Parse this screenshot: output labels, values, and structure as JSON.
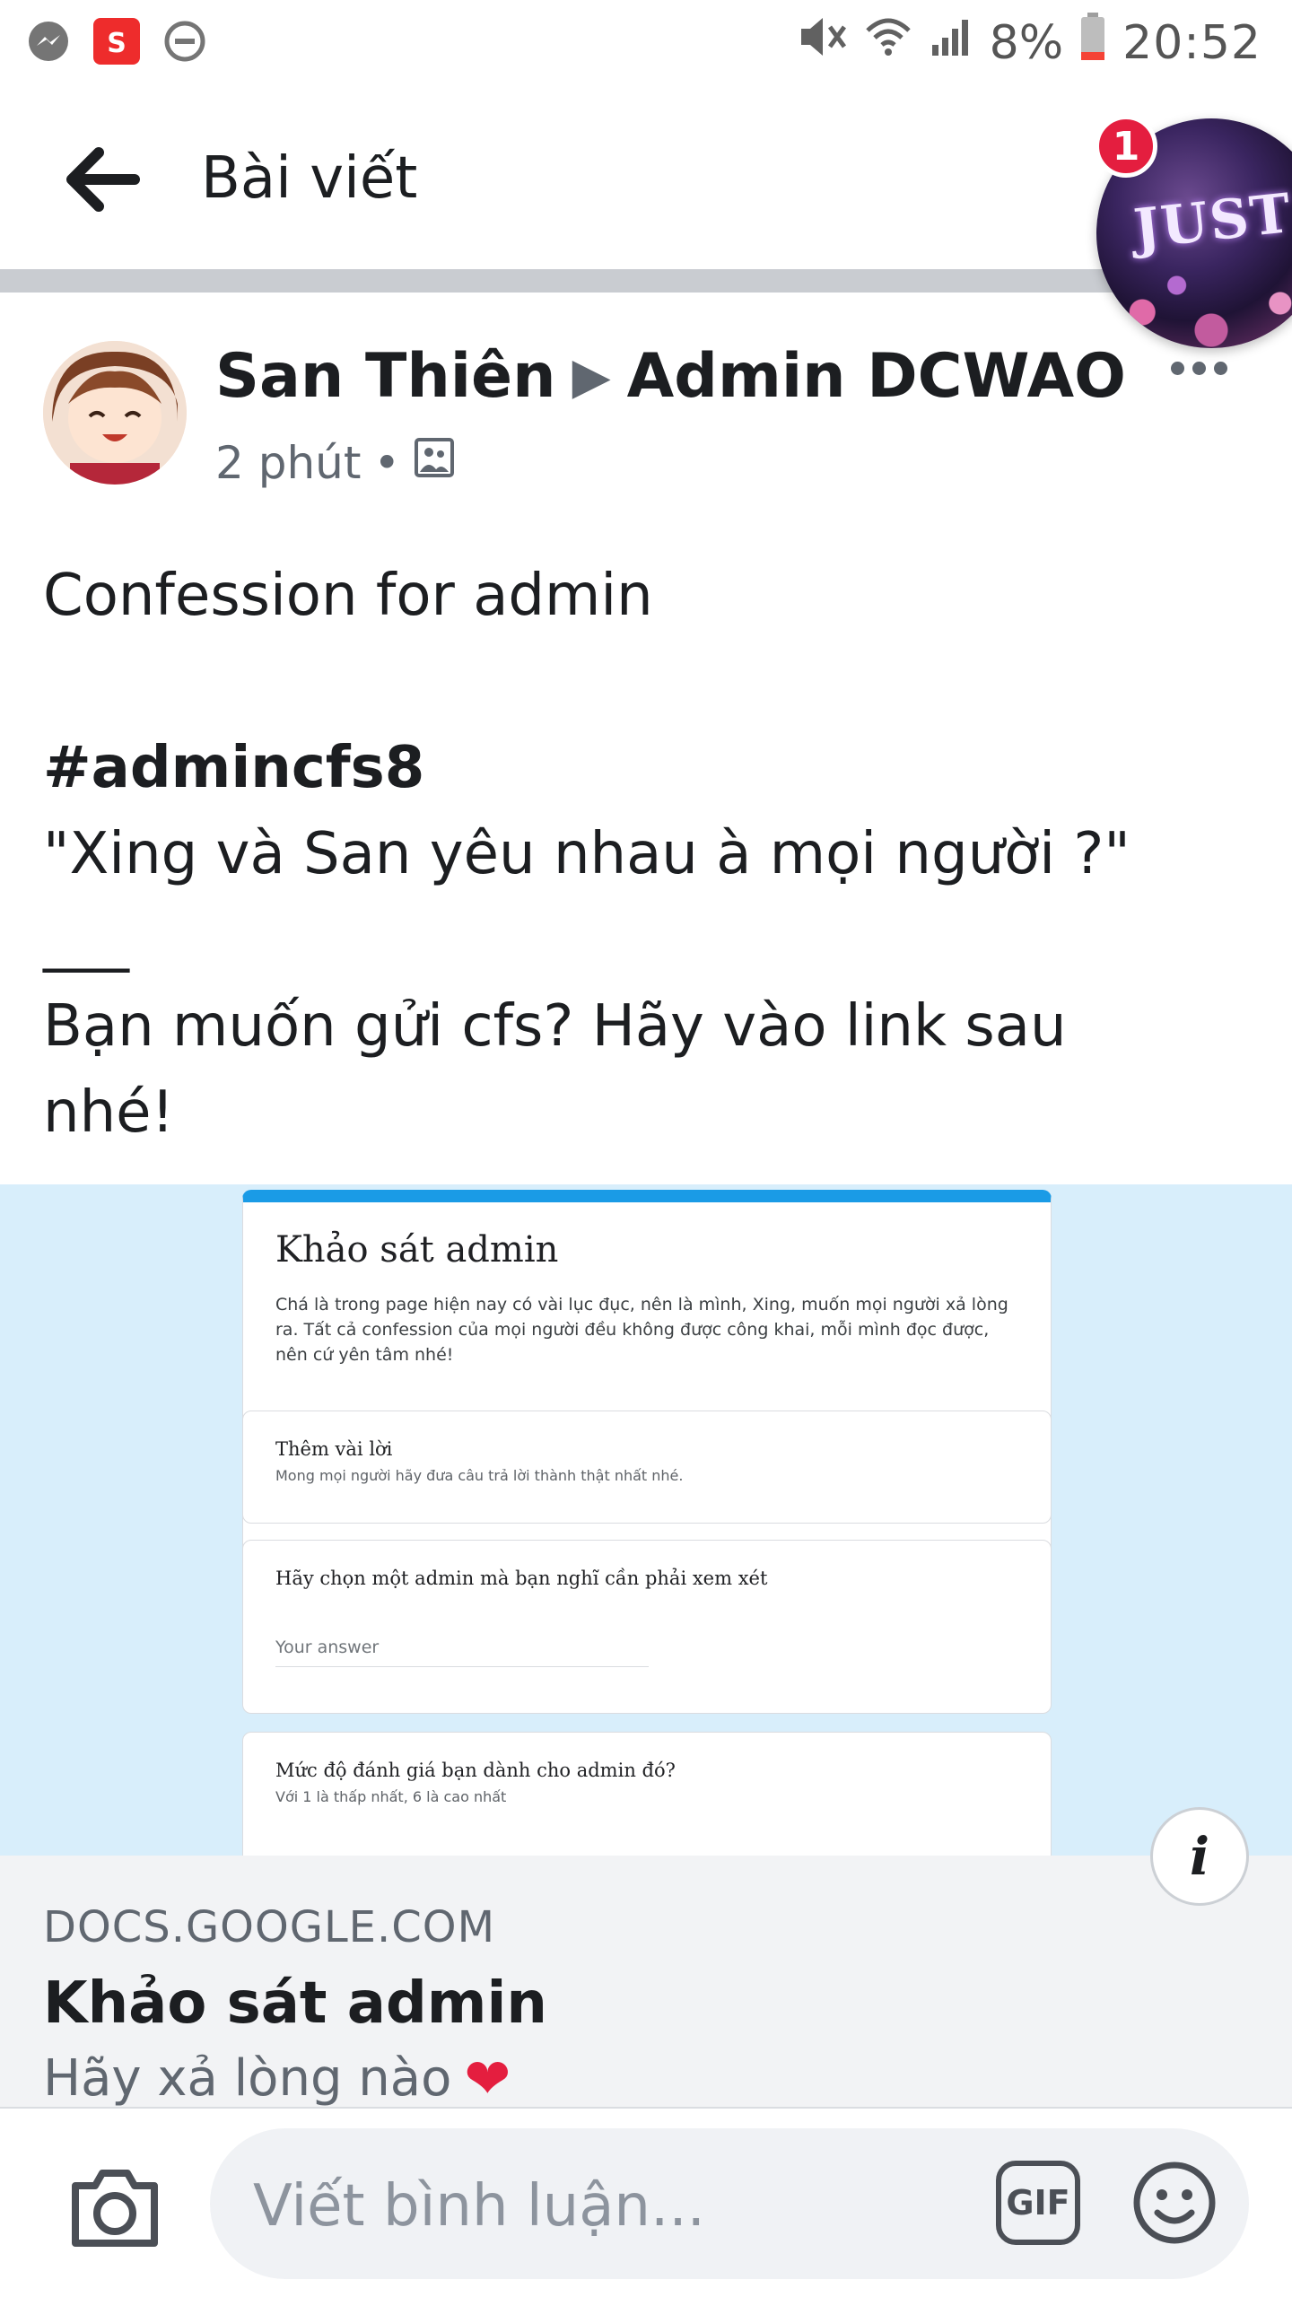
{
  "status_bar": {
    "battery_percent": "8%",
    "time": "20:52",
    "icons": [
      "messenger-icon",
      "shopee-icon",
      "do-not-disturb-icon",
      "mute-icon",
      "wifi-icon",
      "signal-icon",
      "battery-icon"
    ]
  },
  "header": {
    "title": "Bài viết",
    "back_icon": "arrow-left-icon"
  },
  "chat_head": {
    "badge_count": "1",
    "art_text": "JUST"
  },
  "post": {
    "author": "San Thiên",
    "arrow": "▶",
    "target": "Admin DCWAO",
    "time": "2 phút",
    "separator": "•",
    "audience_icon": "group-photo-icon",
    "lines": {
      "l1": "Confession for admin",
      "l2": "#admincfs8",
      "l3": "\"Xing và San yêu nhau à mọi người ?\"",
      "l4": "___",
      "l5": "Bạn muốn gửi cfs? Hãy vào link sau",
      "l6": "nhé!"
    }
  },
  "form_preview": {
    "title": "Khảo sát admin",
    "description": "Chá là trong page hiện nay có vài lục đục, nên là mình, Xing, muốn mọi người xả lòng ra. Tất cả confession của mọi người đều không được công khai, mỗi mình đọc được, nên cứ yên tâm nhé!",
    "section_title": "Thêm vài lời",
    "section_sub": "Mong mọi người hãy đưa câu trả lời thành thật nhất nhé.",
    "q1_title": "Hãy chọn một admin mà bạn nghĩ cần phải xem xét",
    "q1_answer_placeholder": "Your answer",
    "q2_title": "Mức độ đánh giá bạn dành cho admin đó?",
    "q2_sub": "Với 1 là thấp nhất, 6 là cao nhất",
    "accent_color": "#1a9be6"
  },
  "link": {
    "domain": "DOCS.GOOGLE.COM",
    "title": "Khảo sát admin",
    "description": "Hãy xả lòng nào",
    "heart": "❤",
    "info_label": "i"
  },
  "comment_bar": {
    "placeholder": "Viết bình luận...",
    "gif_label": "GIF"
  }
}
